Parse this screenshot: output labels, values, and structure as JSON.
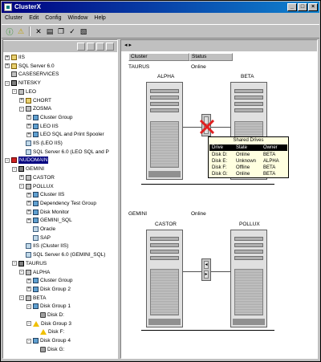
{
  "window": {
    "title": "ClusterX"
  },
  "menu": [
    "Cluster",
    "Edit",
    "Config",
    "Window",
    "Help"
  ],
  "right_pane": {
    "nav": "◂ ▸",
    "columns": [
      "Cluster",
      "Status"
    ],
    "clusters": [
      {
        "name": "TAURUS",
        "status": "Online",
        "nodes": [
          "ALPHA",
          "BETA"
        ]
      },
      {
        "name": "GEMINI",
        "status": "Online",
        "nodes": [
          "CASTOR",
          "POLLUX"
        ]
      }
    ]
  },
  "shared_drives_popup": {
    "title": "Shared Drives",
    "headers": [
      "Drive",
      "State",
      "Owner"
    ],
    "rows": [
      [
        "Disk D:",
        "Online",
        "BETA"
      ],
      [
        "Disk E:",
        "Unknown",
        "ALPHA"
      ],
      [
        "Disk F:",
        "Offline",
        "BETA"
      ],
      [
        "Disk G:",
        "Online",
        "BETA"
      ]
    ]
  },
  "tree": [
    {
      "label": "IIS",
      "depth": 1,
      "box": "+",
      "icon": "folder"
    },
    {
      "label": "SQL Server 6.0",
      "depth": 1,
      "box": "+",
      "icon": "folder"
    },
    {
      "label": "CASESERVICES",
      "depth": 1,
      "box": "",
      "icon": "server"
    },
    {
      "label": "NITESKY",
      "depth": 1,
      "box": "-",
      "icon": "cluster"
    },
    {
      "label": "LEO",
      "depth": 2,
      "box": "-",
      "icon": "server"
    },
    {
      "label": "CHORT",
      "depth": 3,
      "box": "+",
      "icon": "folder"
    },
    {
      "label": "ZOSMA",
      "depth": 3,
      "box": "-",
      "icon": "server"
    },
    {
      "label": "Cluster Group",
      "depth": 4,
      "box": "+",
      "icon": "group"
    },
    {
      "label": "LEO IIS",
      "depth": 4,
      "box": "+",
      "icon": "group"
    },
    {
      "label": "LEO SQL and Print Spooler",
      "depth": 4,
      "box": "+",
      "icon": "group"
    },
    {
      "label": "IIS (LEO IIS)",
      "depth": 3,
      "box": "",
      "icon": "res"
    },
    {
      "label": "SQL Server 6.0 (LEO SQL and P",
      "depth": 3,
      "box": "",
      "icon": "res"
    },
    {
      "label": "NUDOMAIN",
      "depth": 1,
      "box": "-",
      "icon": "red",
      "selected": true
    },
    {
      "label": "GEMINI",
      "depth": 2,
      "box": "-",
      "icon": "cluster"
    },
    {
      "label": "CASTOR",
      "depth": 3,
      "box": "+",
      "icon": "server"
    },
    {
      "label": "POLLUX",
      "depth": 3,
      "box": "-",
      "icon": "server"
    },
    {
      "label": "Cluster IIS",
      "depth": 4,
      "box": "+",
      "icon": "group"
    },
    {
      "label": "Dependency Test Group",
      "depth": 4,
      "box": "+",
      "icon": "group"
    },
    {
      "label": "Disk Monitor",
      "depth": 4,
      "box": "+",
      "icon": "group"
    },
    {
      "label": "GEMINI_SQL",
      "depth": 4,
      "box": "+",
      "icon": "group"
    },
    {
      "label": "Oracle",
      "depth": 4,
      "box": "",
      "icon": "res"
    },
    {
      "label": "SAP",
      "depth": 4,
      "box": "",
      "icon": "res"
    },
    {
      "label": "IIS (Cluster IIS)",
      "depth": 3,
      "box": "",
      "icon": "res"
    },
    {
      "label": "SQL Server 6.0 (GEMINI_SQL)",
      "depth": 3,
      "box": "",
      "icon": "res"
    },
    {
      "label": "TAURUS",
      "depth": 2,
      "box": "-",
      "icon": "cluster"
    },
    {
      "label": "ALPHA",
      "depth": 3,
      "box": "-",
      "icon": "server"
    },
    {
      "label": "Cluster Group",
      "depth": 4,
      "box": "+",
      "icon": "group"
    },
    {
      "label": "Disk Group 2",
      "depth": 4,
      "box": "+",
      "icon": "group"
    },
    {
      "label": "BETA",
      "depth": 3,
      "box": "-",
      "icon": "server"
    },
    {
      "label": "Disk Group 1",
      "depth": 4,
      "box": "-",
      "icon": "group"
    },
    {
      "label": "Disk D:",
      "depth": 5,
      "box": "",
      "icon": "disk"
    },
    {
      "label": "Disk Group 3",
      "depth": 4,
      "box": "-",
      "icon": "warn"
    },
    {
      "label": "Disk F:",
      "depth": 5,
      "box": "",
      "icon": "warn"
    },
    {
      "label": "Disk Group 4",
      "depth": 4,
      "box": "-",
      "icon": "group"
    },
    {
      "label": "Disk G:",
      "depth": 5,
      "box": "",
      "icon": "disk"
    }
  ]
}
